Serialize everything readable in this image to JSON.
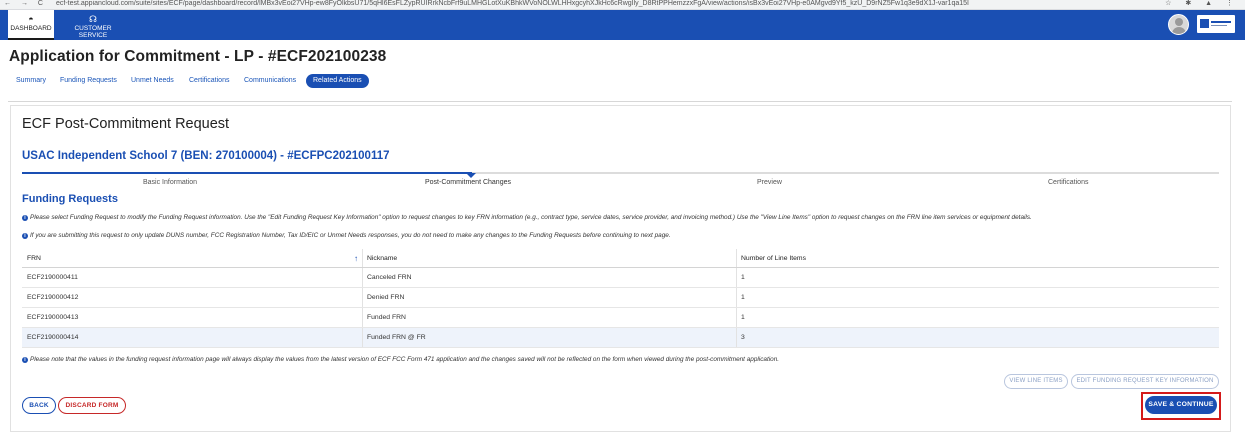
{
  "browser": {
    "nav_glyphs": "← → C",
    "url": "ecf-test.appiancloud.com/suite/sites/ECF/page/dashboard/record/lMBx3vEoi27VHp-ew8FyOlkbsU71/5qHl6EsFLZypRUIRrkNcbFrf9uLMHGLotXuKBhkWVoNOLWLHHxgcyhXJkHc6cRwgIly_D8RtPPHemzzxFgA/view/actions/isBx3vEoi27VHp-e0AMgvd9Yf5_kzU_D9rNZ5Fw1q3e9dX1J-var1qa15I",
    "tool_glyphs": "☆ ✱ ▲ ⋮"
  },
  "appbar": {
    "tabs": [
      {
        "label": "DASHBOARD",
        "icon": "dashboard-gauge-icon",
        "glyph": "◓",
        "active": true
      },
      {
        "label": "CUSTOMER SERVICE",
        "icon": "headset-icon",
        "glyph": "☊",
        "active": false
      }
    ]
  },
  "page_title": "Application for Commitment - LP - #ECF202100238",
  "tabs": [
    {
      "label": "Summary",
      "active": false
    },
    {
      "label": "Funding Requests",
      "active": false
    },
    {
      "label": "Unmet Needs",
      "active": false
    },
    {
      "label": "Certifications",
      "active": false
    },
    {
      "label": "Communications",
      "active": false
    },
    {
      "label": "Related Actions",
      "active": true
    }
  ],
  "form": {
    "title": "ECF Post-Commitment Request",
    "subtitle": "USAC Independent School 7 (BEN: 270100004) - #ECFPC202100117",
    "steps": [
      {
        "label": "Basic Information",
        "status": "complete"
      },
      {
        "label": "Post-Commitment Changes",
        "status": "current"
      },
      {
        "label": "Preview",
        "status": "pending"
      },
      {
        "label": "Certifications",
        "status": "pending"
      }
    ],
    "section_title": "Funding Requests",
    "info_icon": "i",
    "info1": "Please select Funding Request to modify the Funding Request information. Use the \"Edit Funding Request Key Information\" option to request changes to key FRN information (e.g., contract type, service dates, service provider, and invoicing method.) Use the \"View Line Items\" option to request changes on the FRN line item services or equipment details.",
    "info2": "If you are submitting this request to only update DUNS number, FCC Registration Number, Tax ID/EIC or Unmet Needs responses, you do not need to make any changes to the Funding Requests before continuing to next page.",
    "info3": "Please note that the values in the funding request information page will always display the values from the latest version of ECF FCC Form 471 application and the changes saved will not be reflected on the form when viewed during the post-commitment application."
  },
  "grid": {
    "headers": [
      "FRN",
      "Nickname",
      "Number of Line Items"
    ],
    "sort_glyph": "↑",
    "rows": [
      [
        "ECF2190000411",
        "Canceled FRN",
        "1"
      ],
      [
        "ECF2190000412",
        "Denied FRN",
        "1"
      ],
      [
        "ECF2190000413",
        "Funded FRN",
        "1"
      ],
      [
        "ECF2190000414",
        "Funded FRN @ FR",
        "3"
      ]
    ],
    "highlighted_row": 3
  },
  "buttons": {
    "view_line_items": "VIEW LINE ITEMS",
    "edit_key_info": "EDIT FUNDING REQUEST KEY INFORMATION",
    "back": "BACK",
    "discard": "DISCARD FORM",
    "save_continue": "SAVE & CONTINUE"
  },
  "colors": {
    "brand_blue": "#1a4fb3",
    "danger_red": "#c62828",
    "highlight_box": "#d41a1a"
  }
}
